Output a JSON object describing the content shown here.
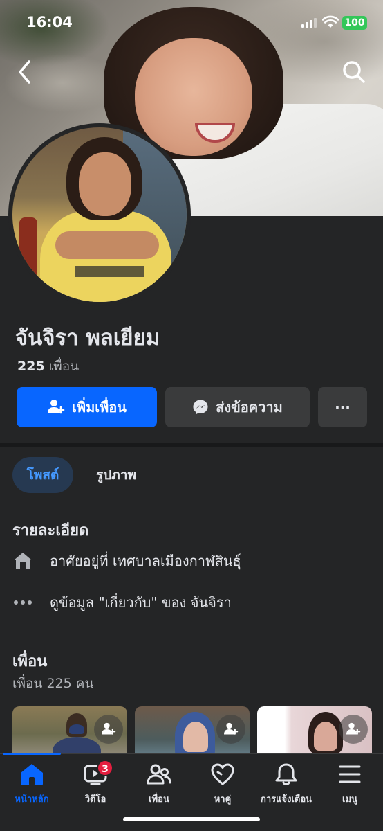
{
  "status_bar": {
    "time": "16:04",
    "battery": "100"
  },
  "profile": {
    "name": "จันจิรา พลเยียม",
    "friends_number": "225",
    "friends_word": "เพื่อน"
  },
  "actions": {
    "add_friend": "เพิ่มเพื่อน",
    "message": "ส่งข้อความ",
    "more": "···"
  },
  "tabs": [
    {
      "label": "โพสต์",
      "active": true
    },
    {
      "label": "รูปภาพ",
      "active": false
    }
  ],
  "details": {
    "title": "รายละเอียด",
    "lives_in": "อาศัยอยู่ที่ เทศบาลเมืองกาฬสินธุ์",
    "see_about": "ดูข้อมูล \"เกี่ยวกับ\" ของ จันจิรา"
  },
  "friends_section": {
    "title": "เพื่อน",
    "subtitle": "เพื่อน 225 คน"
  },
  "nav": [
    {
      "label": "หน้าหลัก",
      "icon": "home-icon",
      "active": true
    },
    {
      "label": "วิดีโอ",
      "icon": "video-icon",
      "badge": "3"
    },
    {
      "label": "เพื่อน",
      "icon": "friends-icon"
    },
    {
      "label": "หาคู่",
      "icon": "dating-heart-icon"
    },
    {
      "label": "การแจ้งเตือน",
      "icon": "bell-icon"
    },
    {
      "label": "เมนู",
      "icon": "menu-icon"
    }
  ],
  "colors": {
    "accent": "#0866ff",
    "background": "#242526",
    "badge": "#e41e3f",
    "battery": "#33c759"
  }
}
